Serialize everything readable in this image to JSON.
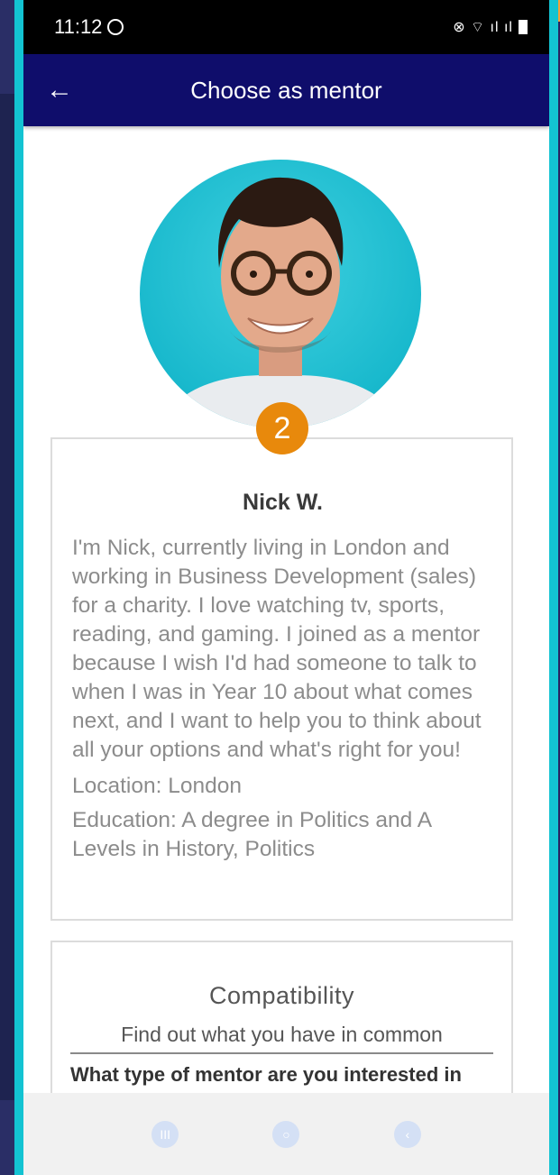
{
  "status_bar": {
    "time": "11:12",
    "whatsapp_icon": "whatsapp-icon",
    "signal_text": "⊗ ⌔ ıl ıl"
  },
  "app_bar": {
    "back_icon": "arrow-left-icon",
    "back_glyph": "←",
    "title": "Choose as mentor"
  },
  "badge": {
    "number": "2"
  },
  "profile": {
    "name": "Nick W.",
    "bio": "I'm Nick, currently living in London and working in Business Development (sales) for a charity. I love watching tv, sports, reading, and gaming. I joined as a mentor because I wish I'd had someone to talk to when I was in Year 10 about what comes next, and I want to help you to think about all your options and what's right for you!",
    "location": "Location: London",
    "education": "Education: A degree in Politics and A Levels in History, Politics"
  },
  "compatibility": {
    "title": "Compatibility",
    "subtitle": "Find out what you have in common",
    "cut_text": "What type of mentor are you interested in"
  },
  "nav_bar": {
    "recent_glyph": "III",
    "home_glyph": "○",
    "back_glyph": "‹"
  },
  "colors": {
    "app_bar": "#0f0d6b",
    "frame": "#13c3d2",
    "badge": "#e8890c",
    "background": "#1e2350"
  }
}
